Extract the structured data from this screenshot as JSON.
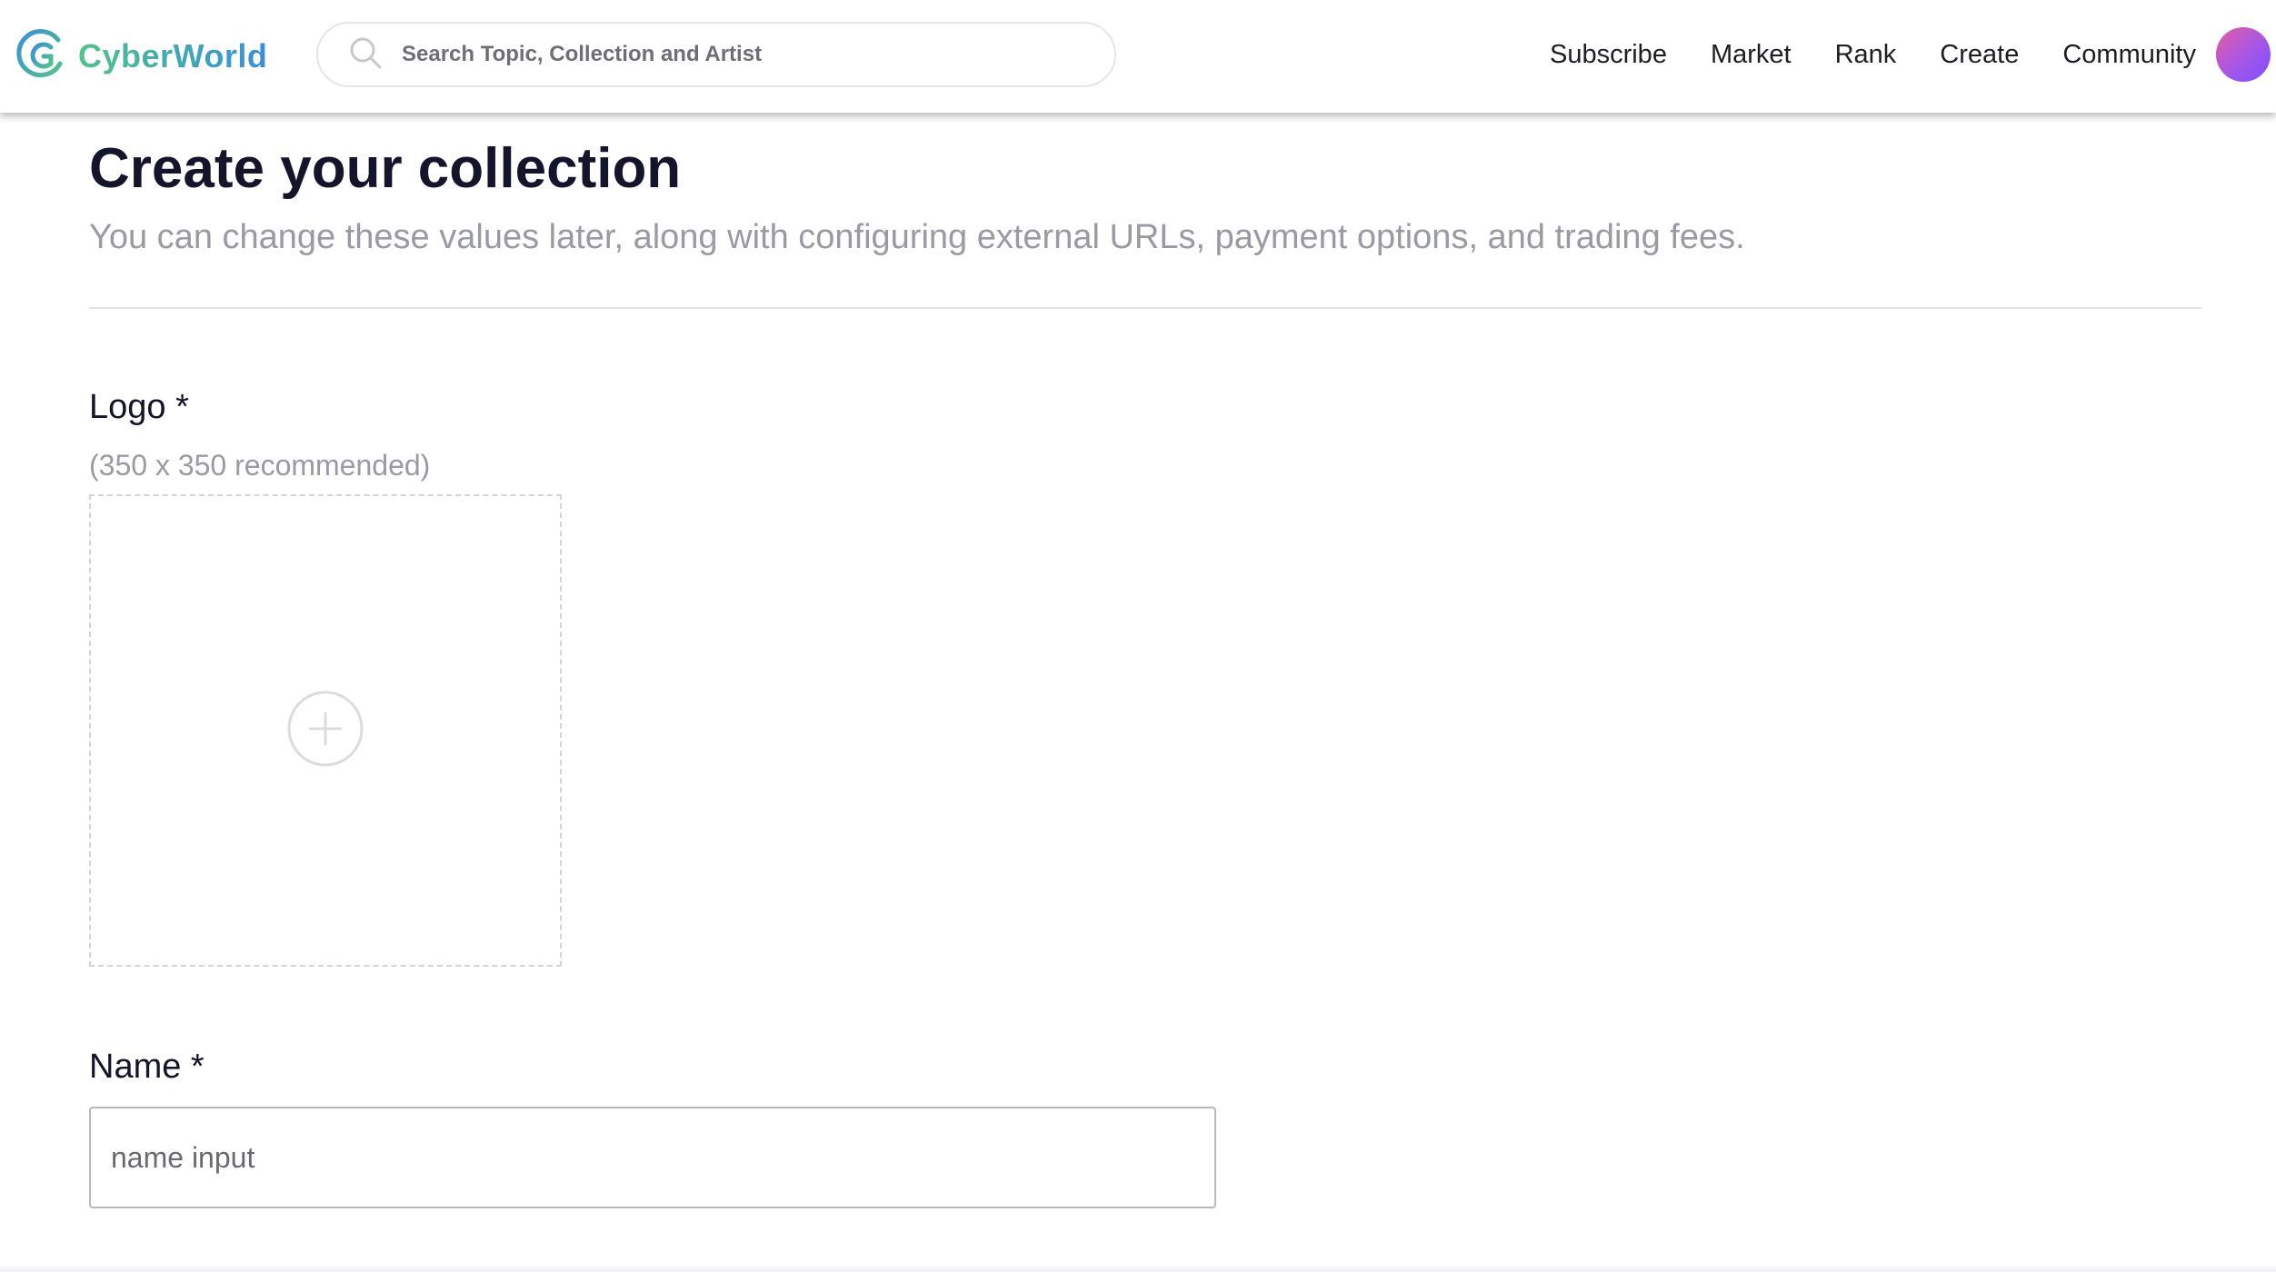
{
  "header": {
    "brand": "CyberWorld",
    "search_placeholder": "Search Topic, Collection and Artist",
    "nav": [
      {
        "label": "Subscribe"
      },
      {
        "label": "Market"
      },
      {
        "label": "Rank"
      },
      {
        "label": "Create"
      },
      {
        "label": "Community"
      }
    ]
  },
  "page": {
    "title": "Create your collection",
    "subtitle": "You can change these values later, along with configuring external URLs, payment options, and trading fees."
  },
  "form": {
    "logo_label": "Logo *",
    "logo_hint": "(350 x 350 recommended)",
    "name_label": "Name *",
    "name_placeholder": "name input",
    "name_value": ""
  },
  "colors": {
    "brand_gradient_start": "#4fc48a",
    "brand_gradient_end": "#3a8fd9",
    "avatar_gradient_start": "#e25ca0",
    "avatar_gradient_end": "#7c4dff"
  },
  "icons": {
    "search": "search-icon",
    "upload": "plus-circle-icon",
    "brand": "cyberworld-logo-icon"
  }
}
